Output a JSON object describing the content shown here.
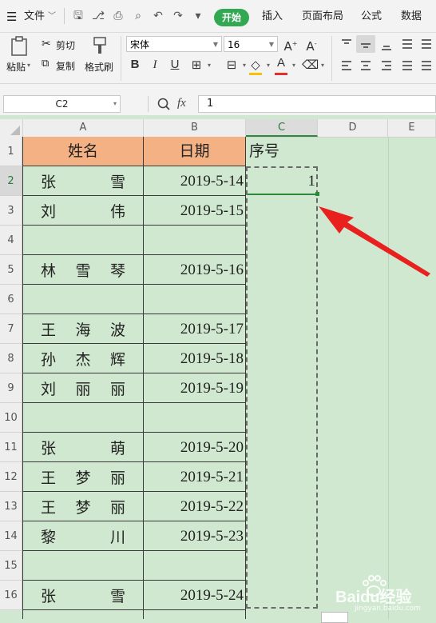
{
  "menubar": {
    "menu_label": "文件",
    "tabs": [
      "开始",
      "插入",
      "页面布局",
      "公式",
      "数据"
    ],
    "quick_access_icons": [
      "save-icon",
      "format-painter-icon",
      "print-icon",
      "print-preview-icon",
      "undo-icon",
      "redo-icon",
      "dropdown-icon"
    ]
  },
  "ribbon": {
    "paste_label": "粘贴",
    "cut_label": "剪切",
    "copy_label": "复制",
    "format_painter_label": "格式刷",
    "font_name": "宋体",
    "font_size": "16",
    "style_buttons": [
      "B",
      "I",
      "U"
    ],
    "accent_color": "#33a853",
    "font_color_bar": "#e03030"
  },
  "formula_bar": {
    "cell_ref": "C2",
    "fx_label": "fx",
    "value": "1"
  },
  "columns": [
    "A",
    "B",
    "C",
    "D",
    "E"
  ],
  "selected_column": "C",
  "selected_row": "2",
  "rows": [
    {
      "num": "1",
      "name": [
        "姓名"
      ],
      "date": "日期",
      "seq": "序号",
      "header": true
    },
    {
      "num": "2",
      "name": [
        "张",
        "雪"
      ],
      "date": "2019-5-14",
      "seq": "1"
    },
    {
      "num": "3",
      "name": [
        "刘",
        "伟"
      ],
      "date": "2019-5-15",
      "seq": ""
    },
    {
      "num": "4",
      "name": [],
      "date": "",
      "seq": ""
    },
    {
      "num": "5",
      "name": [
        "林",
        "雪",
        "琴"
      ],
      "date": "2019-5-16",
      "seq": ""
    },
    {
      "num": "6",
      "name": [],
      "date": "",
      "seq": ""
    },
    {
      "num": "7",
      "name": [
        "王",
        "海",
        "波"
      ],
      "date": "2019-5-17",
      "seq": ""
    },
    {
      "num": "8",
      "name": [
        "孙",
        "杰",
        "辉"
      ],
      "date": "2019-5-18",
      "seq": ""
    },
    {
      "num": "9",
      "name": [
        "刘",
        "丽",
        "丽"
      ],
      "date": "2019-5-19",
      "seq": ""
    },
    {
      "num": "10",
      "name": [],
      "date": "",
      "seq": ""
    },
    {
      "num": "11",
      "name": [
        "张",
        "萌"
      ],
      "date": "2019-5-20",
      "seq": ""
    },
    {
      "num": "12",
      "name": [
        "王",
        "梦",
        "丽"
      ],
      "date": "2019-5-21",
      "seq": ""
    },
    {
      "num": "13",
      "name": [
        "王",
        "梦",
        "丽"
      ],
      "date": "2019-5-22",
      "seq": ""
    },
    {
      "num": "14",
      "name": [
        "黎",
        "川"
      ],
      "date": "2019-5-23",
      "seq": ""
    },
    {
      "num": "15",
      "name": [],
      "date": "",
      "seq": ""
    },
    {
      "num": "16",
      "name": [
        "张",
        "雪"
      ],
      "date": "2019-5-24",
      "seq": ""
    }
  ],
  "annotation": {
    "arrow_color": "#e8211f"
  },
  "watermark": {
    "text": "Baidu经验",
    "subtext": "jingyan.baidu.com"
  }
}
